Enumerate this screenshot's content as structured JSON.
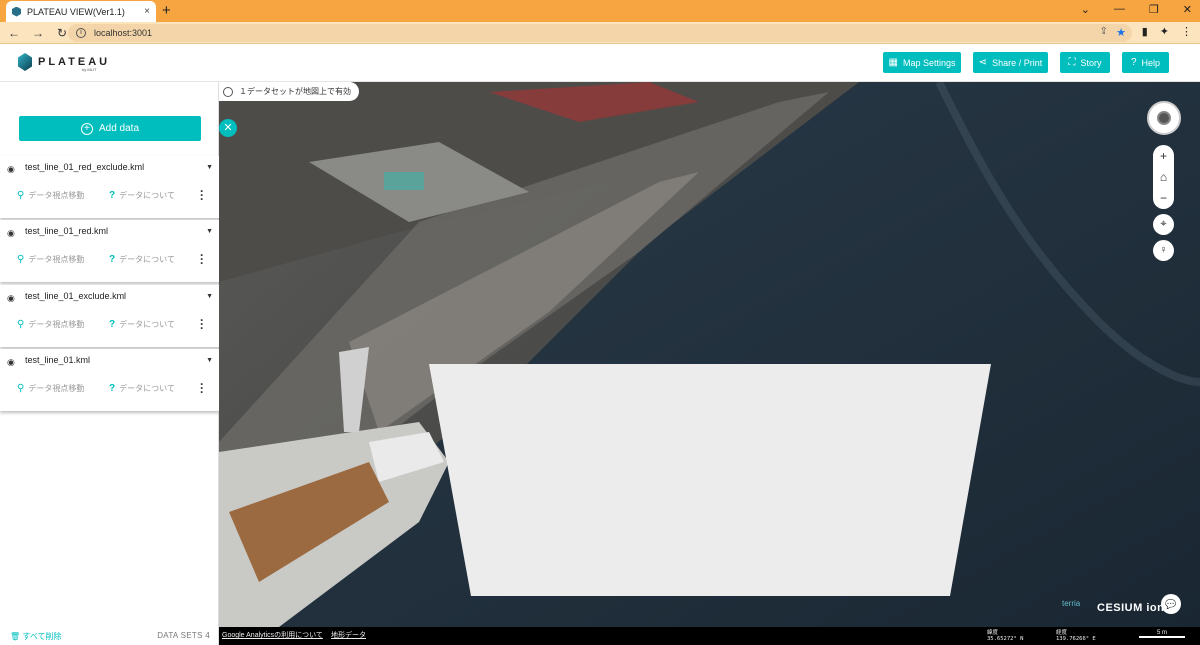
{
  "browser": {
    "tab_title": "PLATEAU VIEW(Ver1.1)",
    "tab_close": "×",
    "new_tab": "+",
    "url": "localhost:3001",
    "win_controls": [
      "⌄",
      "—",
      "❐",
      "✕"
    ]
  },
  "header": {
    "logo_text": "PLATEAU",
    "logo_sub": "by MLIT",
    "buttons": {
      "map_settings": "Map Settings",
      "share": "Share / Print",
      "story": "Story",
      "help": "Help"
    }
  },
  "sidebar": {
    "add_data": "Add data",
    "datasets": [
      {
        "name": "test_line_01_red_exclude.kml",
        "goto": "データ視点移動",
        "about": "データについて"
      },
      {
        "name": "test_line_01_red.kml",
        "goto": "データ視点移動",
        "about": "データについて"
      },
      {
        "name": "test_line_01_exclude.kml",
        "goto": "データ視点移動",
        "about": "データについて"
      },
      {
        "name": "test_line_01.kml",
        "goto": "データ視点移動",
        "about": "データについて"
      }
    ],
    "remove_all": "すべて削除",
    "count": "DATA SETS 4"
  },
  "map": {
    "status_pill": "１データセットが地図上で有効",
    "footer": {
      "analytics": "Google Analyticsの利用について",
      "terrain": "地形データ",
      "lat_label": "緯度",
      "lat_value": "35.65272° N",
      "lon_label": "経度",
      "lon_value": "139.76266° E",
      "scale": "5 m"
    },
    "credits": {
      "terria": "terria",
      "cesium": "CESIUM ion"
    }
  },
  "colors": {
    "accent": "#00bebe",
    "tabbar": "#f7a541"
  }
}
